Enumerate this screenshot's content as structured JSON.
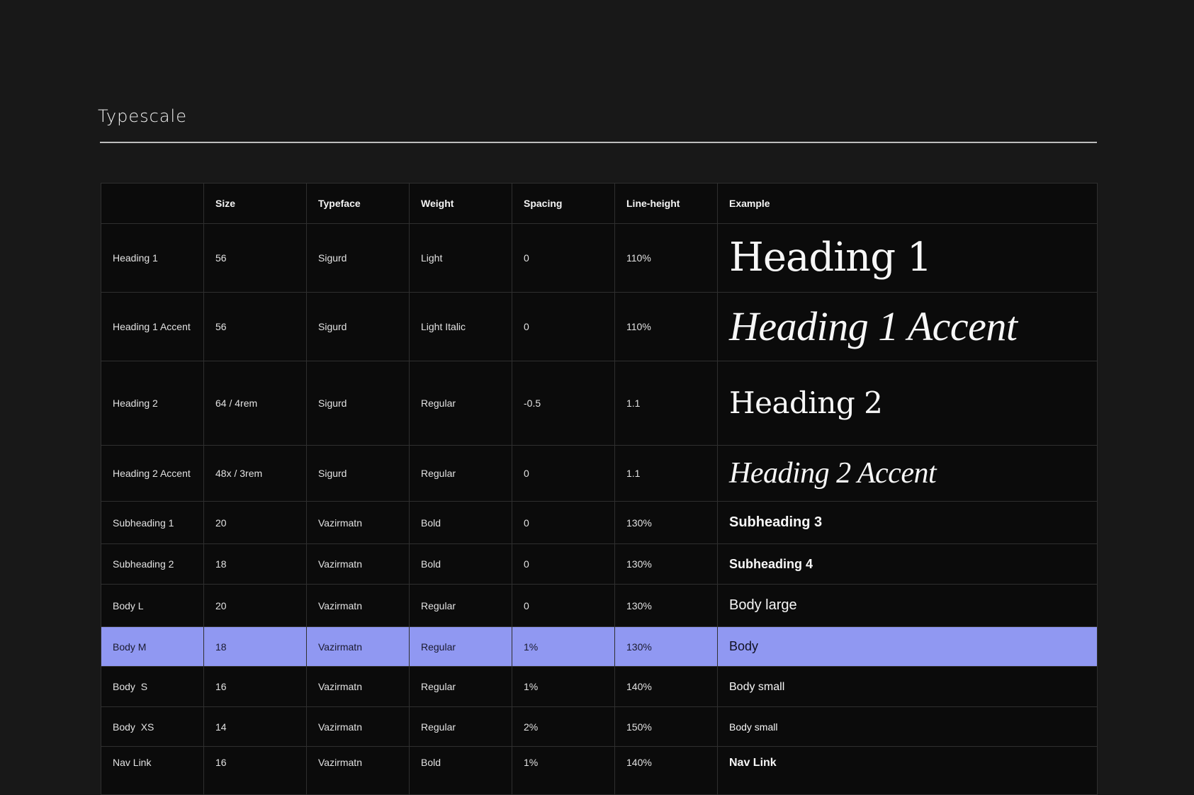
{
  "page": {
    "title": "Typescale"
  },
  "colors": {
    "background": "#181818",
    "table_background": "#0b0b0b",
    "selected_row": "#9098f2",
    "border": "#2f2f2f"
  },
  "table": {
    "headers": [
      "",
      "Size",
      "Typeface",
      "Weight",
      "Spacing",
      "Line-height",
      "Example"
    ],
    "rows": [
      {
        "name": "Heading 1",
        "size": "56",
        "typeface": "Sigurd",
        "weight": "Light",
        "spacing": "0",
        "line_height": "110%",
        "example": "Heading 1"
      },
      {
        "name": "Heading 1 Accent",
        "size": "56",
        "typeface": "Sigurd",
        "weight": "Light Italic",
        "spacing": "0",
        "line_height": "110%",
        "example": "Heading 1 Accent"
      },
      {
        "name": "Heading 2",
        "size": "64 / 4rem",
        "typeface": "Sigurd",
        "weight": "Regular",
        "spacing": "-0.5",
        "line_height": "1.1",
        "example": "Heading 2"
      },
      {
        "name": "Heading 2 Accent",
        "size": "48x / 3rem",
        "typeface": "Sigurd",
        "weight": "Regular",
        "spacing": "0",
        "line_height": "1.1",
        "example": "Heading 2 Accent"
      },
      {
        "name": "Subheading 1",
        "size": "20",
        "typeface": "Vazirmatn",
        "weight": "Bold",
        "spacing": "0",
        "line_height": "130%",
        "example": "Subheading 3"
      },
      {
        "name": "Subheading 2",
        "size": "18",
        "typeface": "Vazirmatn",
        "weight": "Bold",
        "spacing": "0",
        "line_height": "130%",
        "example": "Subheading 4"
      },
      {
        "name": "Body L",
        "size": "20",
        "typeface": "Vazirmatn",
        "weight": "Regular",
        "spacing": "0",
        "line_height": "130%",
        "example": "Body large"
      },
      {
        "name": "Body M",
        "size": "18",
        "typeface": "Vazirmatn",
        "weight": "Regular",
        "spacing": "1%",
        "line_height": "130%",
        "example": "Body",
        "selected": true
      },
      {
        "name": "Body  S",
        "size": "16",
        "typeface": "Vazirmatn",
        "weight": "Regular",
        "spacing": "1%",
        "line_height": "140%",
        "example": "Body small"
      },
      {
        "name": "Body  XS",
        "size": "14",
        "typeface": "Vazirmatn",
        "weight": "Regular",
        "spacing": "2%",
        "line_height": "150%",
        "example": "Body small"
      },
      {
        "name": "Nav Link",
        "size": "16",
        "typeface": "Vazirmatn",
        "weight": "Bold",
        "spacing": "1%",
        "line_height": "140%",
        "example": "Nav Link"
      }
    ]
  }
}
